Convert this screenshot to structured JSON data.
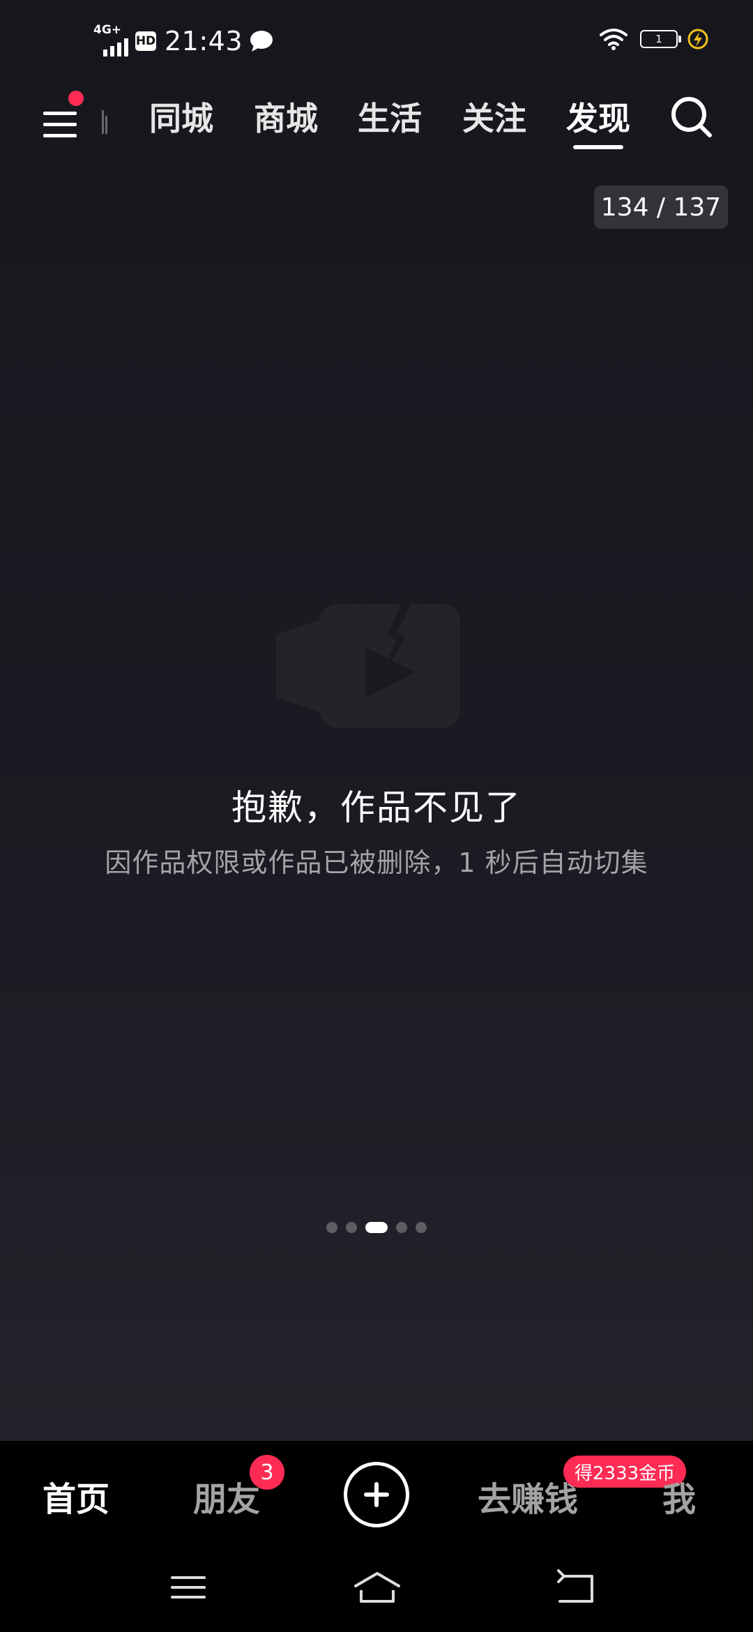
{
  "status_bar": {
    "network": "4G+",
    "hd": "HD",
    "time": "21:43",
    "battery_level": "1"
  },
  "top_nav": {
    "tabs": [
      {
        "label": "同城",
        "active": false
      },
      {
        "label": "商城",
        "active": false
      },
      {
        "label": "生活",
        "active": false
      },
      {
        "label": "关注",
        "active": false
      },
      {
        "label": "发现",
        "active": true
      }
    ]
  },
  "video_counter": "134 / 137",
  "empty_state": {
    "icon": "broken-video-icon",
    "title": "抱歉，作品不见了",
    "subtitle": "因作品权限或作品已被删除，1 秒后自动切集"
  },
  "pager": {
    "count": 5,
    "active_index": 2
  },
  "bottom_nav": {
    "home": "首页",
    "friends": "朋友",
    "friends_badge": "3",
    "earn": "去赚钱",
    "earn_badge": "得2333金币",
    "me": "我"
  },
  "colors": {
    "accent": "#fe2c55",
    "background": "#1b1c23"
  }
}
